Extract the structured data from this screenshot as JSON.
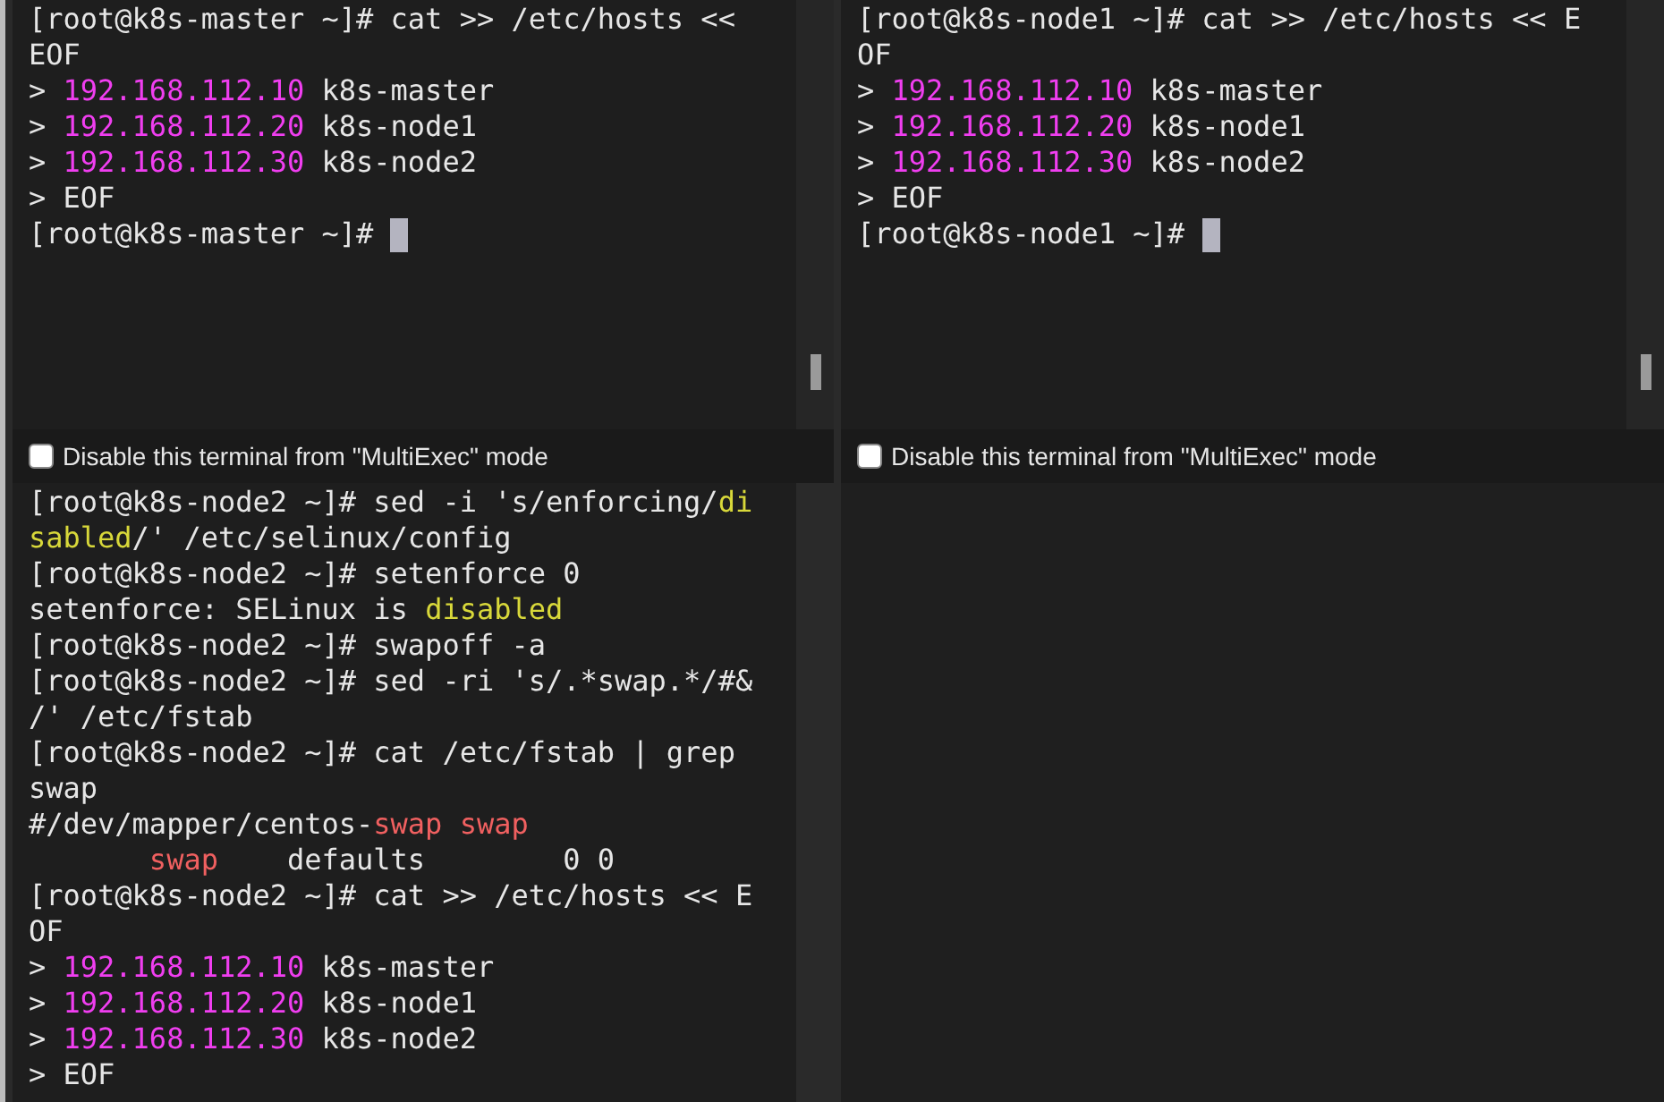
{
  "panes": [
    {
      "lines": [
        [
          {
            "text": "[root@k8s-master ~]# cat >> /etc/hosts <<",
            "kind": "plain"
          }
        ],
        [
          {
            "text": "EOF",
            "kind": "plain"
          }
        ],
        [
          {
            "text": "> ",
            "kind": "plain"
          },
          {
            "text": "192.168.112.10",
            "kind": "number"
          },
          {
            "text": " k8s-master",
            "kind": "plain"
          }
        ],
        [
          {
            "text": "> ",
            "kind": "plain"
          },
          {
            "text": "192.168.112.20",
            "kind": "number"
          },
          {
            "text": " k8s-node1",
            "kind": "plain"
          }
        ],
        [
          {
            "text": "> ",
            "kind": "plain"
          },
          {
            "text": "192.168.112.30",
            "kind": "number"
          },
          {
            "text": " k8s-node2",
            "kind": "plain"
          }
        ],
        [
          {
            "text": "> EOF",
            "kind": "plain"
          }
        ],
        [
          {
            "text": "[root@k8s-master ~]# ",
            "kind": "plain"
          }
        ]
      ],
      "cursor": true,
      "scrollbar": true,
      "multiexec": {
        "label": "Disable this terminal from \"MultiExec\" mode",
        "checked": false
      }
    },
    {
      "lines": [
        [
          {
            "text": "[root@k8s-node1 ~]# cat >> /etc/hosts << E",
            "kind": "plain"
          }
        ],
        [
          {
            "text": "OF",
            "kind": "plain"
          }
        ],
        [
          {
            "text": "> ",
            "kind": "plain"
          },
          {
            "text": "192.168.112.10",
            "kind": "number"
          },
          {
            "text": " k8s-master",
            "kind": "plain"
          }
        ],
        [
          {
            "text": "> ",
            "kind": "plain"
          },
          {
            "text": "192.168.112.20",
            "kind": "number"
          },
          {
            "text": " k8s-node1",
            "kind": "plain"
          }
        ],
        [
          {
            "text": "> ",
            "kind": "plain"
          },
          {
            "text": "192.168.112.30",
            "kind": "number"
          },
          {
            "text": " k8s-node2",
            "kind": "plain"
          }
        ],
        [
          {
            "text": "> EOF",
            "kind": "plain"
          }
        ],
        [
          {
            "text": "[root@k8s-node1 ~]# ",
            "kind": "plain"
          }
        ]
      ],
      "cursor": true,
      "scrollbar": true,
      "multiexec": {
        "label": "Disable this terminal from \"MultiExec\" mode",
        "checked": false
      }
    },
    {
      "lines": [
        [
          {
            "text": "[root@k8s-node2 ~]# sed -i 's/enforcing/",
            "kind": "plain"
          },
          {
            "text": "di",
            "kind": "highlight"
          }
        ],
        [
          {
            "text": "sabled",
            "kind": "highlight"
          },
          {
            "text": "/' /etc/selinux/config",
            "kind": "plain"
          }
        ],
        [
          {
            "text": "[root@k8s-node2 ~]# setenforce 0",
            "kind": "plain"
          }
        ],
        [
          {
            "text": "setenforce: SELinux is ",
            "kind": "plain"
          },
          {
            "text": "disabled",
            "kind": "highlight"
          }
        ],
        [
          {
            "text": "[root@k8s-node2 ~]# swapoff -a",
            "kind": "plain"
          }
        ],
        [
          {
            "text": "[root@k8s-node2 ~]# sed -ri 's/.*swap.*/#&",
            "kind": "plain"
          }
        ],
        [
          {
            "text": "/' /etc/fstab",
            "kind": "plain"
          }
        ],
        [
          {
            "text": "[root@k8s-node2 ~]# cat /etc/fstab | grep",
            "kind": "plain"
          }
        ],
        [
          {
            "text": "swap",
            "kind": "plain"
          }
        ],
        [
          {
            "text": "#/dev/mapper/centos-",
            "kind": "plain"
          },
          {
            "text": "swap swap",
            "kind": "match"
          }
        ],
        [
          {
            "text": "       swap",
            "kind": "match"
          },
          {
            "text": "    defaults        0 0",
            "kind": "plain"
          }
        ],
        [
          {
            "text": "[root@k8s-node2 ~]# cat >> /etc/hosts << E",
            "kind": "plain"
          }
        ],
        [
          {
            "text": "OF",
            "kind": "plain"
          }
        ],
        [
          {
            "text": "> ",
            "kind": "plain"
          },
          {
            "text": "192.168.112.10",
            "kind": "number"
          },
          {
            "text": " k8s-master",
            "kind": "plain"
          }
        ],
        [
          {
            "text": "> ",
            "kind": "plain"
          },
          {
            "text": "192.168.112.20",
            "kind": "number"
          },
          {
            "text": " k8s-node1",
            "kind": "plain"
          }
        ],
        [
          {
            "text": "> ",
            "kind": "plain"
          },
          {
            "text": "192.168.112.30",
            "kind": "number"
          },
          {
            "text": " k8s-node2",
            "kind": "plain"
          }
        ],
        [
          {
            "text": "> EOF",
            "kind": "plain"
          }
        ]
      ],
      "cursor": false,
      "scrollbar": false
    }
  ]
}
